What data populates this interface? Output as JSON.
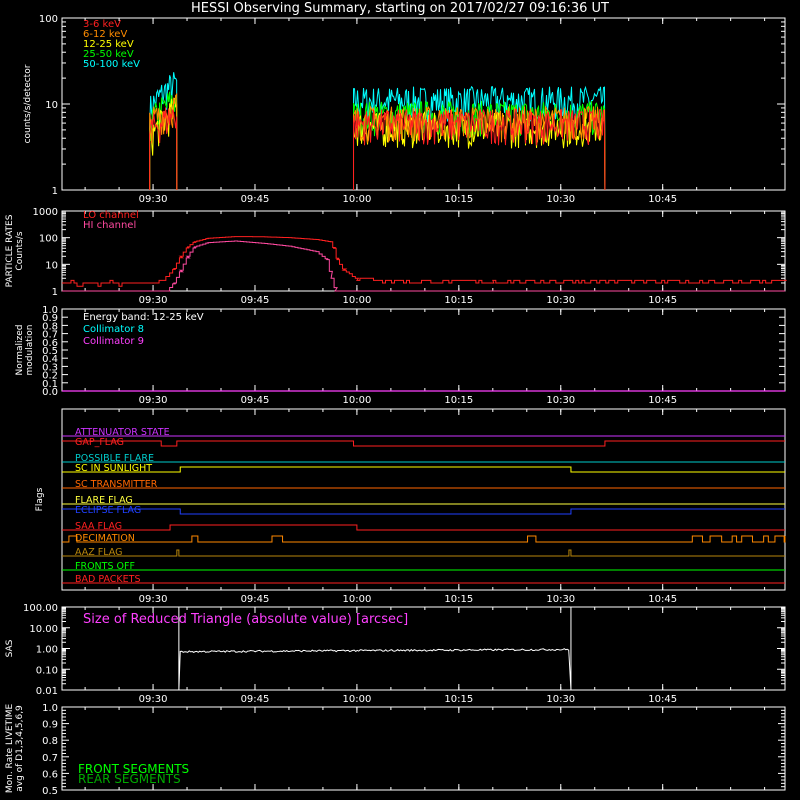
{
  "title": "HESSI Observing Summary, starting on 2017/02/27 09:16:36 UT",
  "colors": {
    "bg": "#000000",
    "axis": "#ffffff",
    "e1": "#ff2020",
    "e2": "#ff8c00",
    "e3": "#ffff00",
    "e4": "#00ff00",
    "e5": "#00ffff",
    "lo": "#ff2020",
    "hi": "#ff4aa0",
    "cyan": "#00ffff",
    "magenta": "#ff40ff",
    "attenuator": "#cc33ff",
    "gap": "#ff2020",
    "possible": "#00cccc",
    "sunlight": "#ffff00",
    "transmitter": "#ff6600",
    "flare": "#ffff40",
    "eclipse": "#2040ff",
    "saa": "#ff2020",
    "decimation": "#ff8800",
    "aaz": "#b8860b",
    "fronts_off": "#00ff00",
    "bad_packets": "#ff2020",
    "sas": "#ffffff",
    "front_seg": "#00ff00",
    "rear_seg": "#00aa00"
  },
  "time_axis": {
    "tick_labels": [
      "09:30",
      "09:45",
      "10:00",
      "10:15",
      "10:30",
      "10:45"
    ],
    "tick_minutes": [
      30,
      45,
      60,
      75,
      90,
      105
    ],
    "xlim_minutes": [
      16.6,
      123.0
    ]
  },
  "chart_data": [
    {
      "type": "line",
      "panel": "counts",
      "ylabel": "counts/s/detector",
      "yscale": "log",
      "ylim": [
        1,
        100
      ],
      "ytick_labels": [
        "1",
        "10",
        "100"
      ],
      "legend_placement": "top-left",
      "legend": [
        "3-6 keV",
        "6-12 keV",
        "12-25 keV",
        "25-50 keV",
        "50-100 keV"
      ],
      "series": [
        {
          "name": "3-6 keV",
          "color": "#ff2020",
          "segments": [
            {
              "x_start": 29.5,
              "x_end": 33.5,
              "y_start": 5,
              "y_end": 8
            },
            {
              "x_start": 59.5,
              "x_end": 96.5,
              "y_start": 6,
              "y_end": 6
            }
          ]
        },
        {
          "name": "6-12 keV",
          "color": "#ff8c00",
          "segments": [
            {
              "x_start": 29.5,
              "x_end": 33.5,
              "y_start": 6,
              "y_end": 10
            },
            {
              "x_start": 59.5,
              "x_end": 96.5,
              "y_start": 6.5,
              "y_end": 6.5
            }
          ]
        },
        {
          "name": "12-25 keV",
          "color": "#ffff00",
          "segments": [
            {
              "x_start": 29.5,
              "x_end": 33.5,
              "y_start": 4,
              "y_end": 9
            },
            {
              "x_start": 59.5,
              "x_end": 96.5,
              "y_start": 5.5,
              "y_end": 5.5
            }
          ]
        },
        {
          "name": "25-50 keV",
          "color": "#00ff00",
          "segments": [
            {
              "x_start": 29.5,
              "x_end": 33.5,
              "y_start": 6,
              "y_end": 12
            },
            {
              "x_start": 59.5,
              "x_end": 96.5,
              "y_start": 7.5,
              "y_end": 7.5
            }
          ]
        },
        {
          "name": "50-100 keV",
          "color": "#00ffff",
          "segments": [
            {
              "x_start": 29.5,
              "x_end": 33.5,
              "y_start": 9,
              "y_end": 18
            },
            {
              "x_start": 59.5,
              "x_end": 96.5,
              "y_start": 11,
              "y_end": 11
            }
          ]
        }
      ]
    },
    {
      "type": "line",
      "panel": "particle",
      "ylabel": "PARTICLE RATES Counts/s",
      "yscale": "log",
      "ylim": [
        1,
        1000
      ],
      "ytick_labels": [
        "1",
        "10",
        "100",
        "1000"
      ],
      "legend_placement": "top-left",
      "legend": [
        "LO channel",
        "HI channel"
      ],
      "series": [
        {
          "name": "LO channel",
          "color": "#ff2020",
          "x": [
            16.6,
            30,
            31,
            32,
            33,
            34,
            35,
            36,
            38,
            42,
            46,
            50,
            54,
            56,
            56.5,
            57,
            58,
            60,
            62,
            70,
            80,
            90,
            100,
            110,
            123
          ],
          "y": [
            2,
            2,
            2.5,
            3.5,
            7,
            20,
            45,
            70,
            95,
            110,
            108,
            100,
            85,
            70,
            40,
            15,
            6,
            3,
            2.5,
            2.2,
            2.2,
            2.3,
            2.2,
            2.2,
            2.3
          ]
        },
        {
          "name": "HI channel",
          "color": "#ff4aa0",
          "x": [
            16.6,
            32,
            33,
            34,
            35,
            36,
            38,
            42,
            46,
            50,
            54,
            55.5,
            56.2,
            56.8,
            123
          ],
          "y": [
            1,
            1,
            2,
            6,
            20,
            45,
            65,
            75,
            62,
            48,
            30,
            15,
            3,
            1,
            1
          ]
        }
      ]
    },
    {
      "type": "line",
      "panel": "modulation",
      "ylabel": "Normalized modulation",
      "ylim": [
        0.0,
        1.0
      ],
      "ytick_labels": [
        "0.0",
        "0.1",
        "0.2",
        "0.3",
        "0.4",
        "0.5",
        "0.6",
        "0.7",
        "0.8",
        "0.9",
        "1.0"
      ],
      "legend_placement": "top-left",
      "legend": [
        "Energy band: 12-25 keV",
        "Collimator 8",
        "Collimator 9"
      ],
      "series": [
        {
          "name": "Collimator 8",
          "color": "#00ffff",
          "x": [
            16.6,
            123
          ],
          "y": [
            0,
            0
          ]
        },
        {
          "name": "Collimator 9",
          "color": "#ff40ff",
          "x": [
            16.6,
            123
          ],
          "y": [
            0,
            0
          ]
        }
      ]
    },
    {
      "type": "line",
      "panel": "flags",
      "ylabel": "Flags",
      "flags": [
        {
          "name": "ATTENUATOR STATE",
          "color": "#cc33ff",
          "steps": [
            [
              16.6,
              0
            ],
            [
              123,
              0
            ]
          ]
        },
        {
          "name": "GAP_FLAG",
          "color": "#ff2020",
          "steps": [
            [
              16.6,
              1
            ],
            [
              31.2,
              0
            ],
            [
              33.5,
              1
            ],
            [
              59.5,
              0
            ],
            [
              96.5,
              1
            ],
            [
              123,
              1
            ]
          ]
        },
        {
          "name": "POSSIBLE FLARE",
          "color": "#00cccc",
          "steps": [
            [
              16.6,
              0
            ],
            [
              123,
              0
            ]
          ]
        },
        {
          "name": "SC IN SUNLIGHT",
          "color": "#ffff00",
          "steps": [
            [
              16.6,
              0
            ],
            [
              34,
              1
            ],
            [
              91.5,
              0
            ],
            [
              123,
              0
            ]
          ]
        },
        {
          "name": "SC TRANSMITTER",
          "color": "#ff6600",
          "steps": [
            [
              16.6,
              0
            ],
            [
              123,
              0
            ]
          ]
        },
        {
          "name": "FLARE FLAG",
          "color": "#ffff40",
          "steps": [
            [
              16.6,
              0
            ],
            [
              123,
              0
            ]
          ]
        },
        {
          "name": "ECLIPSE FLAG",
          "color": "#2040ff",
          "steps": [
            [
              16.6,
              1
            ],
            [
              34,
              0
            ],
            [
              91.5,
              1
            ],
            [
              123,
              1
            ]
          ]
        },
        {
          "name": "SAA FLAG",
          "color": "#ff2020",
          "steps": [
            [
              16.6,
              0
            ],
            [
              32.5,
              1
            ],
            [
              60,
              0
            ],
            [
              123,
              0
            ]
          ]
        },
        {
          "name": "DECIMATION",
          "color": "#ff8800",
          "steps": [
            [
              16.6,
              1
            ],
            [
              123,
              1
            ]
          ]
        },
        {
          "name": "AAZ FLAG",
          "color": "#b8860b",
          "steps": [
            [
              16.6,
              0
            ],
            [
              123,
              0
            ]
          ]
        },
        {
          "name": "FRONTS OFF",
          "color": "#00ff00",
          "steps": [
            [
              16.6,
              0
            ],
            [
              123,
              0
            ]
          ]
        },
        {
          "name": "BAD PACKETS",
          "color": "#ff2020",
          "steps": [
            [
              16.6,
              0
            ],
            [
              123,
              0
            ]
          ]
        }
      ]
    },
    {
      "type": "line",
      "panel": "sas",
      "ylabel": "SAS",
      "yscale": "log",
      "ylim": [
        0.01,
        100
      ],
      "ytick_labels": [
        "0.01",
        "0.10",
        "1.00",
        "10.00",
        "100.00"
      ],
      "annotation": "Size of Reduced Triangle (absolute value) [arcsec]",
      "series": [
        {
          "name": "",
          "color": "#ffffff",
          "x": [
            33.8,
            34.0,
            40,
            50,
            60,
            70,
            80,
            90,
            91.3,
            91.5
          ],
          "y": [
            100,
            0.7,
            0.75,
            0.78,
            0.8,
            0.82,
            0.84,
            0.88,
            0.9,
            100
          ]
        }
      ]
    },
    {
      "type": "line",
      "panel": "livetime",
      "ylabel": "Mon. Rate LIVETIME avg of D1,3,4,5,6,9",
      "ylim": [
        0.5,
        1.0
      ],
      "ytick_labels": [
        "0.5",
        "0.6",
        "0.7",
        "0.8",
        "0.9",
        "1.0"
      ],
      "legend_placement": "bottom-left",
      "legend": [
        "FRONT SEGMENTS",
        "REAR SEGMENTS"
      ]
    }
  ]
}
